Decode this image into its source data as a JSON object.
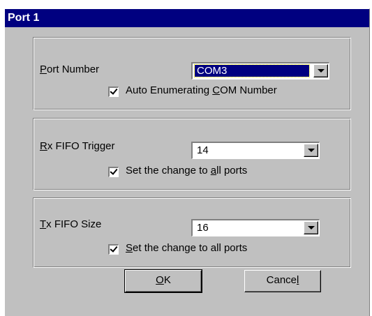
{
  "window": {
    "title": "Port 1"
  },
  "port_group": {
    "label": "Port Number",
    "selected": "COM3",
    "checkbox_label": "Auto Enumerating COM Number",
    "checked": true
  },
  "rx_group": {
    "label": "Rx FIFO Trigger",
    "selected": "14",
    "checkbox_label": "Set the change to all ports",
    "checked": true
  },
  "tx_group": {
    "label": "Tx FIFO Size",
    "selected": "16",
    "checkbox_label": "Set the change to all ports",
    "checked": true
  },
  "buttons": {
    "ok": "OK",
    "cancel": "Cancel"
  },
  "colors": {
    "titlebar": "#000080",
    "face": "#c0c0c0",
    "highlight": "#000080"
  },
  "icons": [
    "chevron-down-icon",
    "checkmark-icon"
  ]
}
